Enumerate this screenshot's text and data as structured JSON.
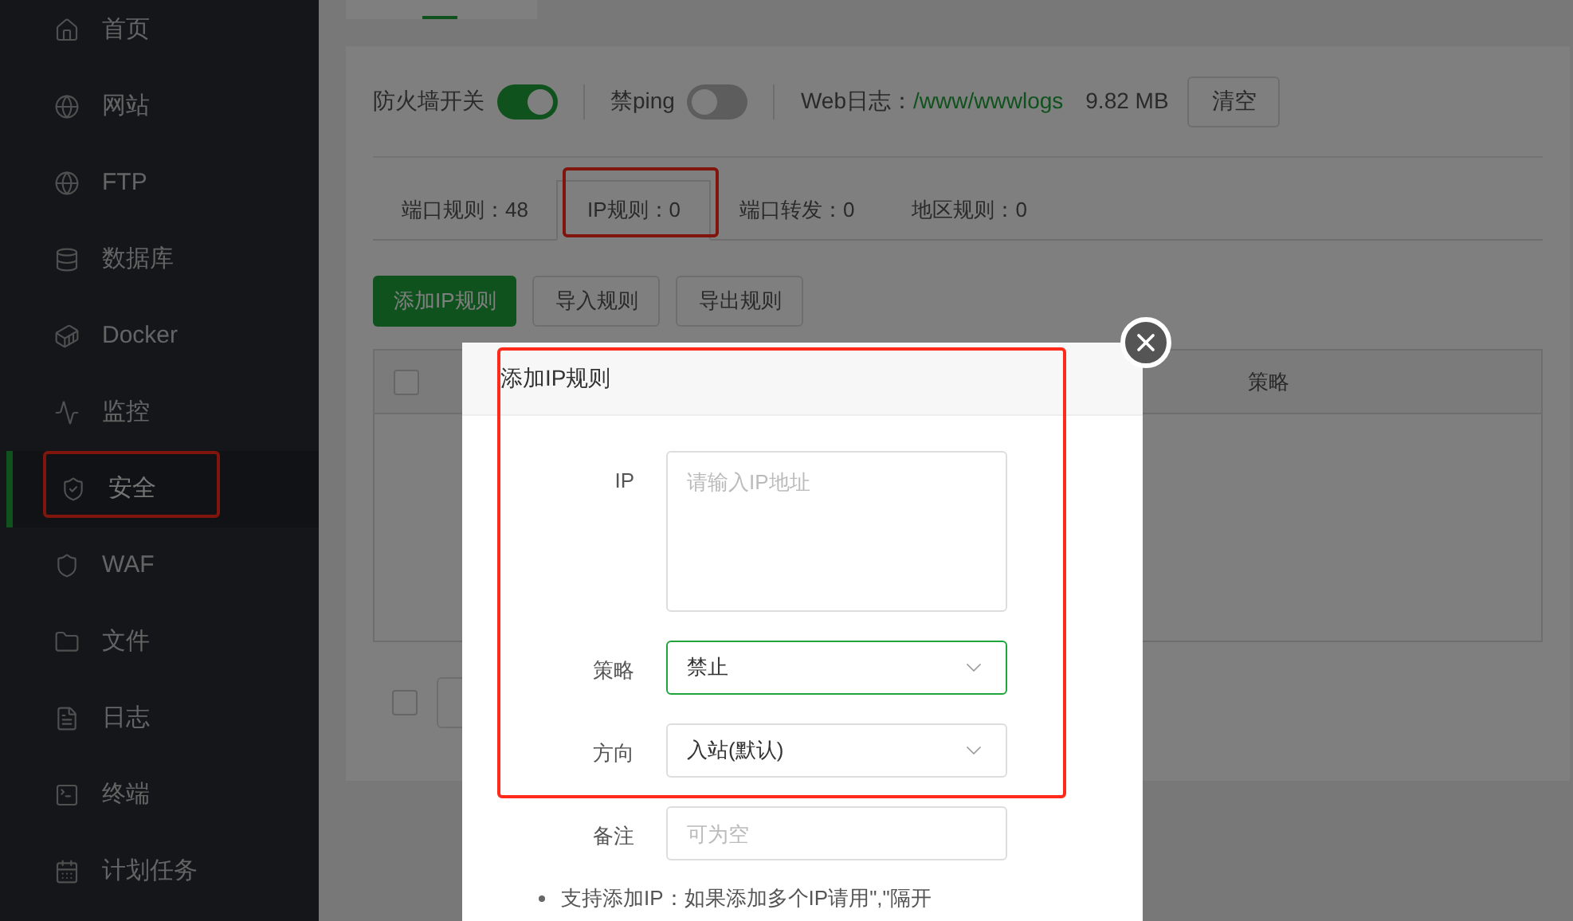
{
  "sidebar": {
    "items": [
      {
        "label": "首页",
        "selected": false,
        "highlighted": false
      },
      {
        "label": "网站",
        "selected": false,
        "highlighted": false
      },
      {
        "label": "FTP",
        "selected": false,
        "highlighted": false
      },
      {
        "label": "数据库",
        "selected": false,
        "highlighted": false
      },
      {
        "label": "Docker",
        "selected": false,
        "highlighted": false
      },
      {
        "label": "监控",
        "selected": false,
        "highlighted": false
      },
      {
        "label": "安全",
        "selected": true,
        "highlighted": true
      },
      {
        "label": "WAF",
        "selected": false,
        "highlighted": false
      },
      {
        "label": "文件",
        "selected": false,
        "highlighted": false
      },
      {
        "label": "日志",
        "selected": false,
        "highlighted": false
      },
      {
        "label": "终端",
        "selected": false,
        "highlighted": false
      },
      {
        "label": "计划任务",
        "selected": false,
        "highlighted": false
      }
    ]
  },
  "switches": [
    {
      "label": "防火墙开关",
      "on": true
    },
    {
      "label": "禁ping",
      "on": false
    }
  ],
  "web_log": {
    "label": "Web日志：",
    "path": "/www/wwwlogs",
    "size": "9.82 MB",
    "button": "清空"
  },
  "tabs": [
    {
      "label": "端口规则：48",
      "selected": false,
      "highlighted": false
    },
    {
      "label": "IP规则：0",
      "selected": true,
      "highlighted": true
    },
    {
      "label": "端口转发：0",
      "selected": false,
      "highlighted": false
    },
    {
      "label": "地区规则：0",
      "selected": false,
      "highlighted": false
    }
  ],
  "actions": [
    {
      "label": "添加IP规则",
      "kind": "primary"
    },
    {
      "label": "导入规则",
      "kind": "default"
    },
    {
      "label": "导出规则",
      "kind": "default"
    }
  ],
  "table": {
    "columns": [
      "策略"
    ],
    "select_all_checked": false
  },
  "batch": {
    "checked": false
  },
  "modal": {
    "title": "添加IP规则",
    "highlighted": true,
    "fields": [
      {
        "label": "IP",
        "kind": "textarea",
        "placeholder": "请输入IP地址"
      },
      {
        "label": "策略",
        "kind": "select",
        "value": "禁止",
        "focused": true
      },
      {
        "label": "方向",
        "kind": "select",
        "value": "入站(默认)",
        "focused": false
      },
      {
        "label": "备注",
        "kind": "input",
        "placeholder": "可为空"
      }
    ],
    "note": "支持添加IP：如果添加多个IP请用\",\"隔开"
  }
}
